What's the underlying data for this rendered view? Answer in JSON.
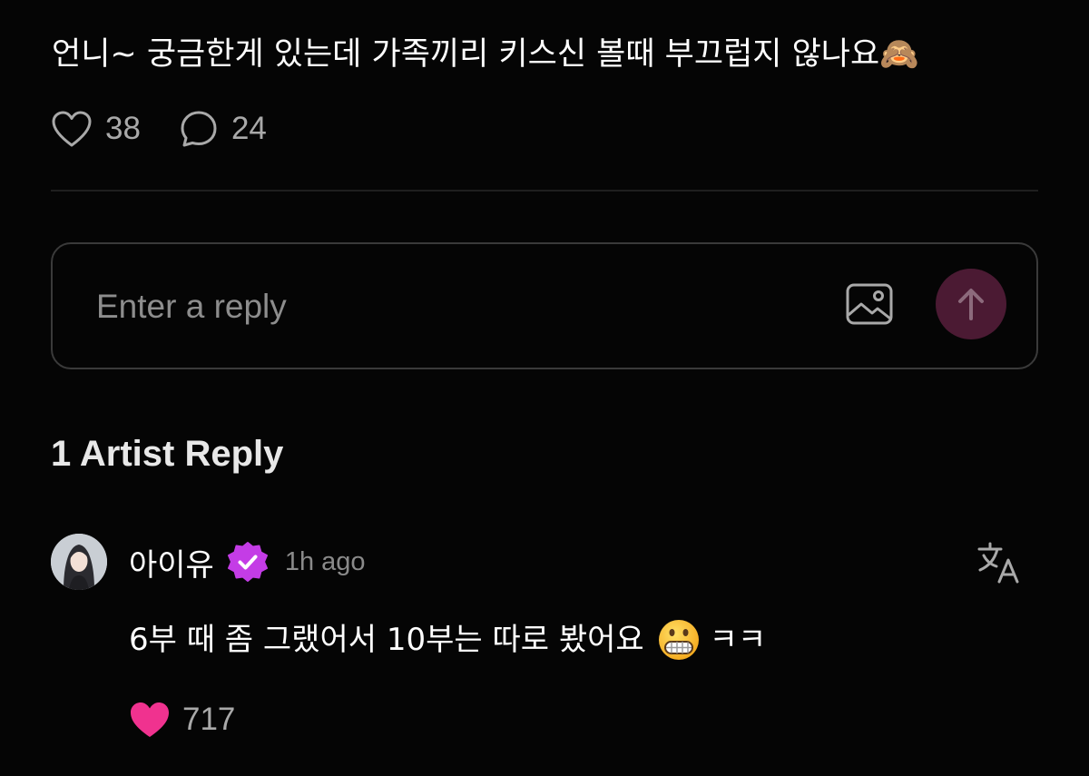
{
  "post": {
    "text": "언니~ 궁금한게 있는데 가족끼리 키스신 볼때 부끄럽지 않나요🙈",
    "like_count": "38",
    "comment_count": "24"
  },
  "reply_box": {
    "placeholder": "Enter a reply"
  },
  "artist_replies": {
    "title": "1 Artist Reply",
    "reply": {
      "author": "아이유",
      "time": "1h ago",
      "text_before_emoji": "6부 때 좀 그랬어서 10부는 따로 봤어요",
      "emoji": "grimacing-face",
      "text_after_emoji": "ㅋㅋ",
      "like_count": "717"
    }
  },
  "icons": {
    "like": "heart-outline-icon",
    "comment": "speech-bubble-icon",
    "image": "image-icon",
    "send": "arrow-up-icon",
    "verified": "verified-badge-icon",
    "translate": "translate-icon",
    "reply_like": "heart-filled-icon"
  },
  "colors": {
    "background": "#050505",
    "send_button": "#4b1a33",
    "verified_badge": "#c43ce6",
    "liked_heart": "#f0328f",
    "muted_text": "#a9a9a9"
  }
}
